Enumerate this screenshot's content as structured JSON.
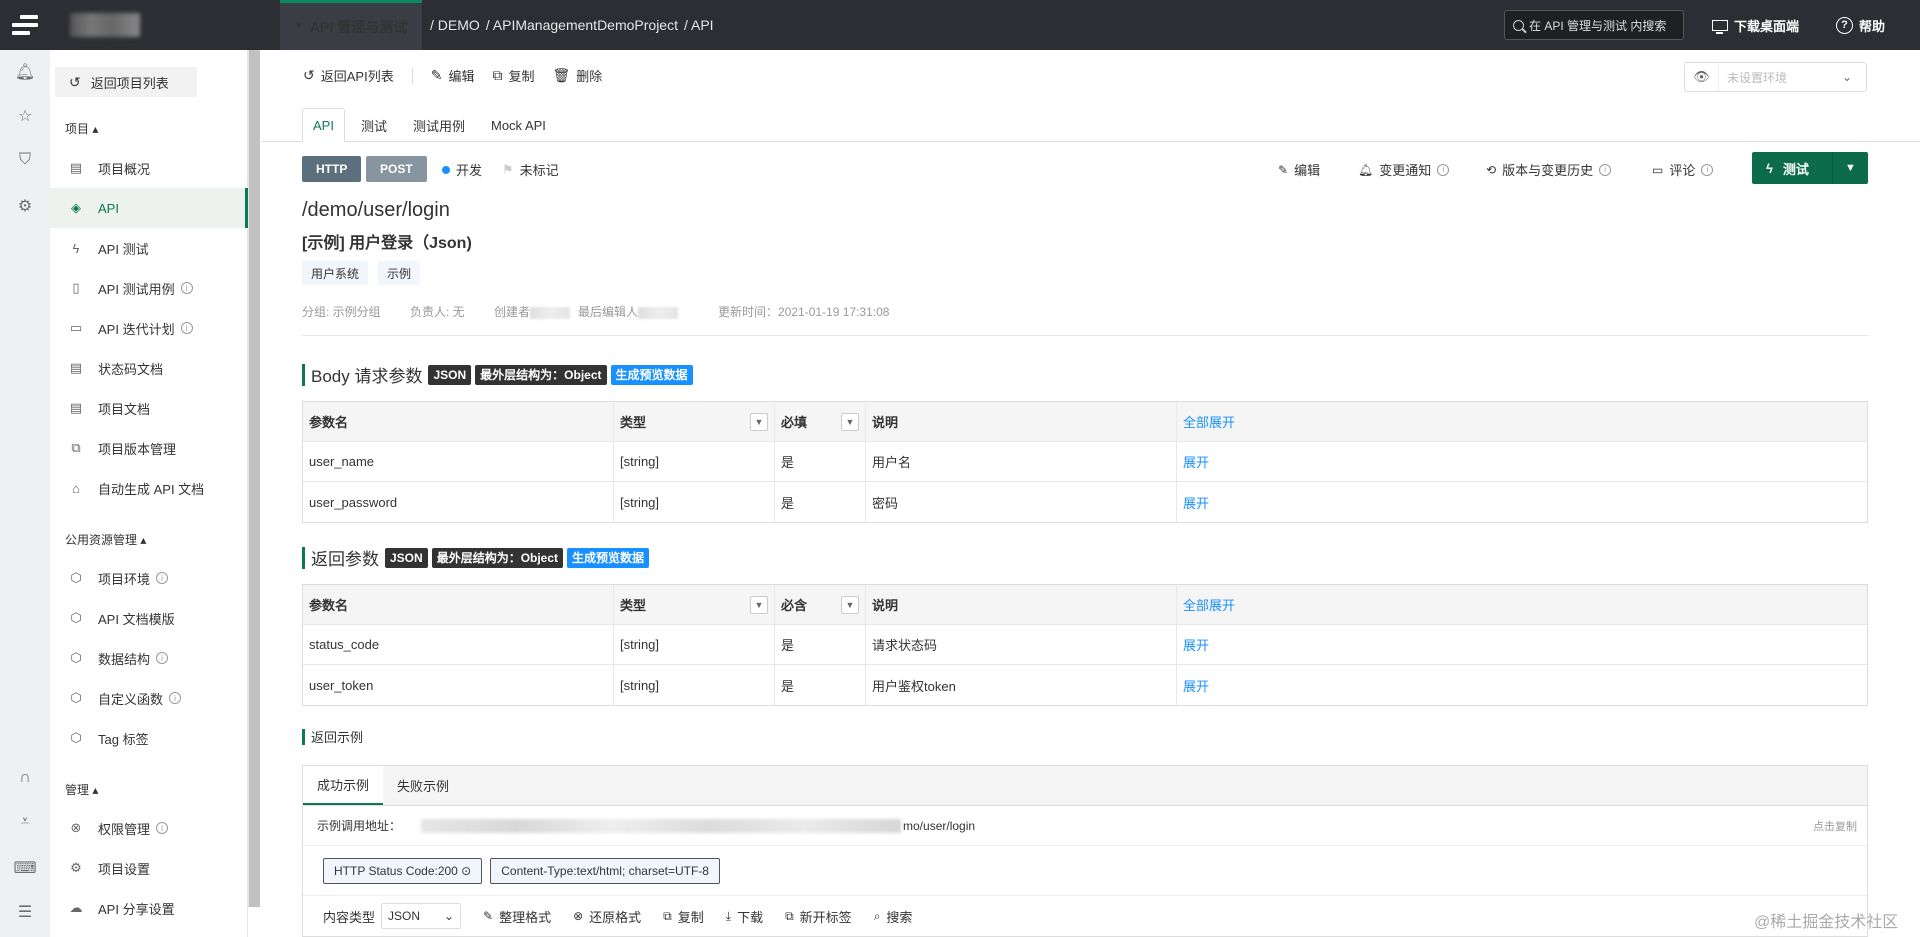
{
  "topbar": {
    "project_switch": "API 管理与测试",
    "breadcrumb": [
      "/ DEMO",
      "/ APIManagementDemoProject",
      "/ API"
    ],
    "search_placeholder": "在 API 管理与测试 内搜索",
    "download_label": "下载桌面端",
    "help_label": "帮助"
  },
  "sidebar": {
    "back_label": "返回项目列表",
    "section_project": "项目 ▴",
    "project_items": [
      {
        "label": "项目概况",
        "icon": "overview-icon"
      },
      {
        "label": "API",
        "icon": "api-icon",
        "active": true
      },
      {
        "label": "API 测试",
        "icon": "lightning-icon"
      },
      {
        "label": "API 测试用例",
        "icon": "clipboard-icon",
        "info": true
      },
      {
        "label": "API 迭代计划",
        "icon": "calendar-icon",
        "info": true
      },
      {
        "label": "状态码文档",
        "icon": "code-doc-icon"
      },
      {
        "label": "项目文档",
        "icon": "document-icon"
      },
      {
        "label": "项目版本管理",
        "icon": "version-icon"
      },
      {
        "label": "自动生成 API 文档",
        "icon": "robot-icon"
      }
    ],
    "section_public": "公用资源管理 ▴",
    "public_items": [
      {
        "label": "项目环境",
        "icon": "cube-icon",
        "info": true
      },
      {
        "label": "API 文档模版",
        "icon": "cube-icon"
      },
      {
        "label": "数据结构",
        "icon": "cube-icon",
        "info": true
      },
      {
        "label": "自定义函数",
        "icon": "cube-icon",
        "info": true
      },
      {
        "label": "Tag 标签",
        "icon": "cube-icon"
      }
    ],
    "section_manage": "管理 ▴",
    "manage_items": [
      {
        "label": "权限管理",
        "icon": "permission-icon",
        "info": true
      },
      {
        "label": "项目设置",
        "icon": "settings-icon"
      },
      {
        "label": "API 分享设置",
        "icon": "cloud-icon"
      }
    ]
  },
  "toolbar": {
    "back_label": "返回API列表",
    "edit_label": "编辑",
    "copy_label": "复制",
    "delete_label": "删除",
    "env_placeholder": "未设置环境"
  },
  "tabs": [
    "API",
    "测试",
    "测试用例",
    "Mock API"
  ],
  "api": {
    "protocol": "HTTP",
    "method": "POST",
    "status": "开发",
    "mark": "未标记",
    "path": "/demo/user/login",
    "title": "[示例] 用户登录（Json)",
    "tags": [
      "用户系统",
      "示例"
    ],
    "meta_group": "分组: 示例分组",
    "meta_owner": "负责人: 无",
    "meta_creator": "创建者",
    "meta_editor": "最后编辑人",
    "meta_updated": "更新时间：2021-01-19 17:31:08"
  },
  "actions": {
    "edit": "编辑",
    "notify": "变更通知",
    "history": "版本与变更历史",
    "comment": "评论",
    "test": "测试"
  },
  "body_section": {
    "title": "Body 请求参数",
    "tag_json": "JSON",
    "tag_outer": "最外层结构为：Object",
    "tag_gen": "生成预览数据",
    "headers": [
      "参数名",
      "类型",
      "必填",
      "说明",
      "全部展开"
    ],
    "rows": [
      {
        "name": "user_name",
        "type": "[string]",
        "required": "是",
        "desc": "用户名",
        "action": "展开"
      },
      {
        "name": "user_password",
        "type": "[string]",
        "required": "是",
        "desc": "密码",
        "action": "展开"
      }
    ]
  },
  "return_section": {
    "title": "返回参数",
    "tag_json": "JSON",
    "tag_outer": "最外层结构为：Object",
    "tag_gen": "生成预览数据",
    "headers": [
      "参数名",
      "类型",
      "必含",
      "说明",
      "全部展开"
    ],
    "rows": [
      {
        "name": "status_code",
        "type": "[string]",
        "required": "是",
        "desc": "请求状态码",
        "action": "展开"
      },
      {
        "name": "user_token",
        "type": "[string]",
        "required": "是",
        "desc": "用户鉴权token",
        "action": "展开"
      }
    ]
  },
  "example": {
    "title": "返回示例",
    "tabs": [
      "成功示例",
      "失败示例"
    ],
    "url_label": "示例调用地址：",
    "url_suffix": "mo/user/login",
    "copy_label": "点击复制",
    "status_badge": "HTTP Status Code:200 ⊙",
    "content_type_badge": "Content-Type:text/html; charset=UTF-8",
    "content_type_label": "内容类型",
    "content_type_value": "JSON",
    "tools": [
      "整理格式",
      "还原格式",
      "复制",
      "下载",
      "新开标签",
      "搜索"
    ]
  },
  "watermark": "@稀土掘金技术社区",
  "colors": {
    "accent": "#0b7a54",
    "topbar": "#2c2e33",
    "link": "#1890ff",
    "tag_dark": "#333333",
    "tag_blue": "#1890ff"
  }
}
